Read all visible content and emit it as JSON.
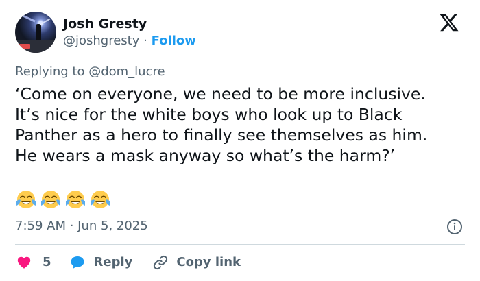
{
  "author": {
    "name": "Josh Gresty",
    "handle": "@joshgresty",
    "separator": "·",
    "follow_label": "Follow"
  },
  "replying_to": "Replying to @dom_lucre",
  "tweet": {
    "text": "‘Come on everyone, we need to be more inclusive.\nIt’s nice for the white boys who look up to Black\nPanther as a hero to finally see themselves as him.\nHe wears a mask anyway so what’s the harm?’",
    "emojis": [
      "face-with-tears-of-joy",
      "face-with-tears-of-joy",
      "face-with-tears-of-joy",
      "face-with-tears-of-joy"
    ]
  },
  "timestamp": "7:59 AM · Jun 5, 2025",
  "actions": {
    "like_count": "5",
    "reply_label": "Reply",
    "copy_link_label": "Copy link"
  },
  "colors": {
    "accent": "#1d9bf0",
    "like": "#f91880",
    "secondary_text": "#536471",
    "divider": "#cfd9de"
  },
  "icons": [
    "x-logo",
    "info-icon",
    "heart-icon",
    "reply-bubble-icon",
    "link-icon"
  ]
}
